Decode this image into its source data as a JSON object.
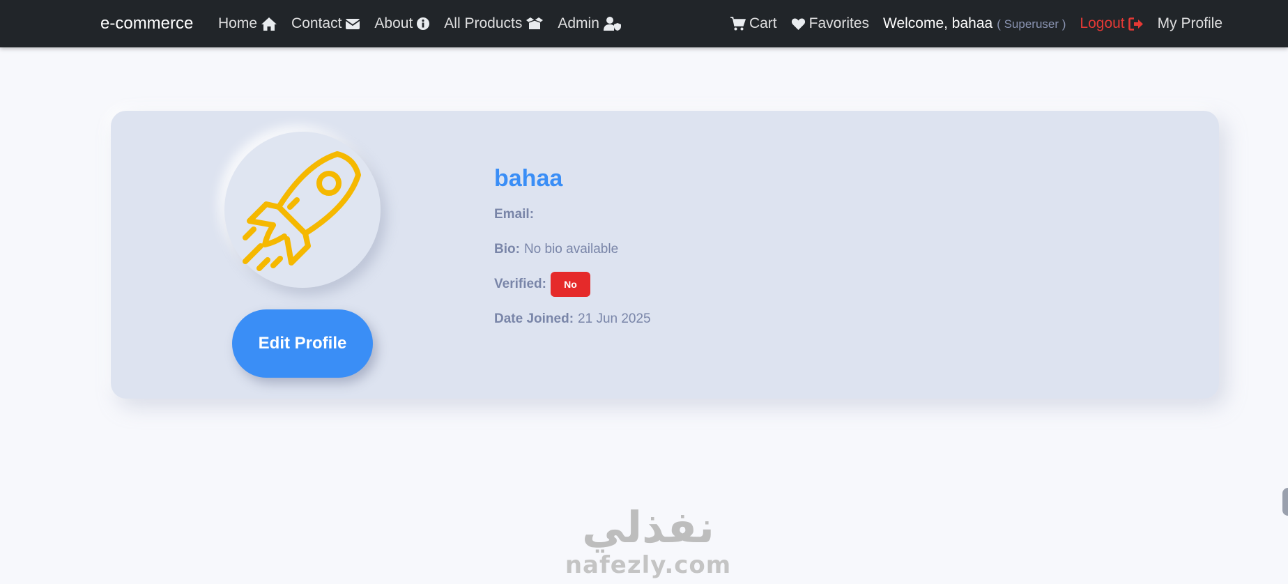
{
  "navbar": {
    "brand": "e-commerce",
    "left_links": [
      {
        "label": "Home",
        "icon": "home-icon"
      },
      {
        "label": "Contact",
        "icon": "envelope-icon"
      },
      {
        "label": "About",
        "icon": "info-circle-icon"
      },
      {
        "label": "All Products",
        "icon": "box-open-icon"
      },
      {
        "label": "Admin",
        "icon": "user-shield-icon"
      }
    ],
    "cart_label": "Cart",
    "favorites_label": "Favorites",
    "welcome_text": "Welcome, bahaa",
    "role_text": "( Superuser )",
    "logout_label": "Logout",
    "my_profile_label": "My Profile"
  },
  "profile": {
    "username": "bahaa",
    "avatar_icon": "rocket-icon",
    "email_label": "Email:",
    "email_value": "",
    "bio_label": "Bio:",
    "bio_value": "No bio available",
    "verified_label": "Verified:",
    "verified_value": "No",
    "date_joined_label": "Date Joined:",
    "date_joined_value": "21 Jun 2025",
    "edit_button_label": "Edit Profile"
  },
  "watermark": {
    "arabic": "نفذلي",
    "latin": "nafezly.com"
  },
  "colors": {
    "navbar_bg": "#212529",
    "accent_blue": "#3a8ef6",
    "danger_red": "#e52a2a",
    "logout_red": "#e53935",
    "card_bg": "#dde3f0",
    "rocket_yellow": "#f5b800",
    "muted_text": "#7985a8"
  }
}
